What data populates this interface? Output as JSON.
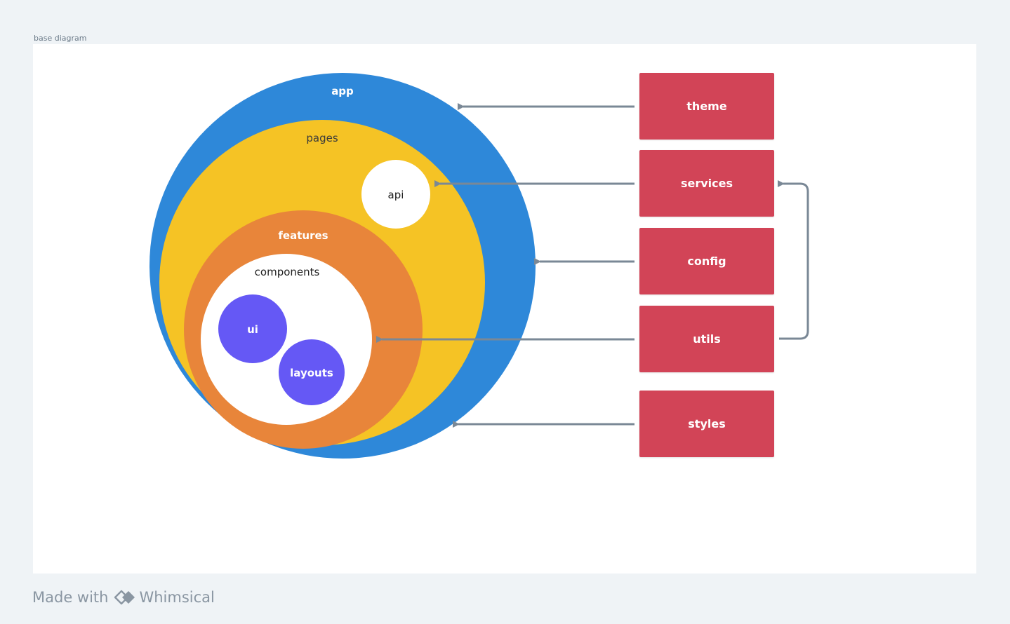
{
  "frame": {
    "title": "base diagram"
  },
  "layers": {
    "app": "app",
    "pages": "pages",
    "api": "api",
    "features": "features",
    "components": "components",
    "ui": "ui",
    "layouts": "layouts"
  },
  "modules": {
    "theme": "theme",
    "services": "services",
    "config": "config",
    "utils": "utils",
    "styles": "styles"
  },
  "colors": {
    "app": "#2e88d9",
    "pages": "#f5c325",
    "features": "#e8853a",
    "components": "#ffffff",
    "leaf": "#6558f5",
    "module_box": "#d24457",
    "arrow": "#7a8896"
  },
  "footer": {
    "made_with": "Made with",
    "brand": "Whimsical",
    "logo_icon": "whimsical-logo-icon"
  }
}
